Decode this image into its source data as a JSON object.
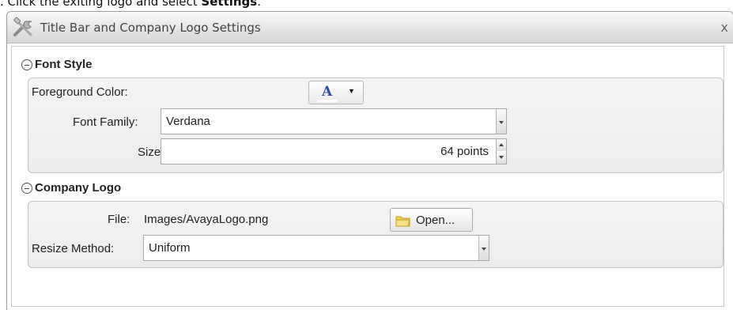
{
  "instruction": {
    "prefix": ". Click the exiting logo and select ",
    "bold": "Settings",
    "suffix": "."
  },
  "dialog": {
    "title": "Title Bar and Company Logo Settings",
    "close": "x"
  },
  "font_style": {
    "header": "Font Style",
    "foreground_label": "Foreground Color:",
    "color_glyph": "A",
    "font_family_label": "Font Family:",
    "font_family_value": "Verdana",
    "size_label": "Size:",
    "size_value": "64 points"
  },
  "company_logo": {
    "header": "Company Logo",
    "file_label": "File:",
    "file_value": "Images/AvayaLogo.png",
    "open_button": "Open...",
    "resize_label": "Resize Method:",
    "resize_value": "Uniform"
  },
  "colors": {
    "glyph": "#2f4fa8",
    "group_bg": "#efefef",
    "border": "#c4c4c4"
  },
  "icons": [
    "tools-icon",
    "close-icon",
    "collapse-icon",
    "dropdown-arrow-icon",
    "spin-up-icon",
    "spin-down-icon",
    "folder-icon"
  ]
}
